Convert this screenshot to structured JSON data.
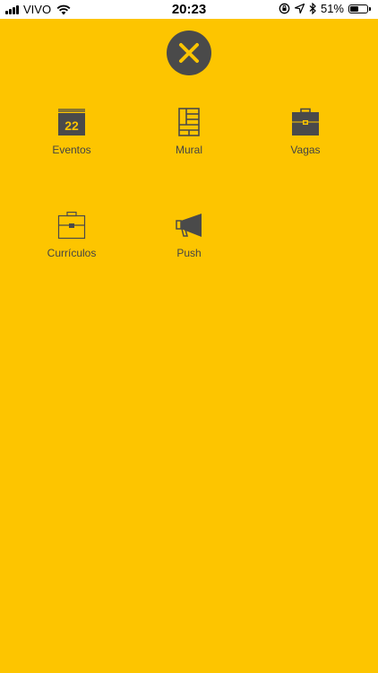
{
  "status_bar": {
    "carrier": "VIVO",
    "time": "20:23",
    "battery_percent": "51%",
    "battery_level": 0.51
  },
  "close_button": {
    "icon": "close-icon"
  },
  "menu": {
    "eventos": {
      "label": "Eventos",
      "icon": "calendar-icon",
      "calendar_day": "22"
    },
    "mural": {
      "label": "Mural",
      "icon": "board-icon"
    },
    "vagas": {
      "label": "Vagas",
      "icon": "briefcase-icon"
    },
    "curriculos": {
      "label": "Currículos",
      "icon": "briefcase-outline-icon"
    },
    "push": {
      "label": "Push",
      "icon": "megaphone-icon"
    }
  },
  "colors": {
    "background": "#fdc500",
    "icon": "#4a4a4a",
    "close_x": "#fdc500"
  }
}
